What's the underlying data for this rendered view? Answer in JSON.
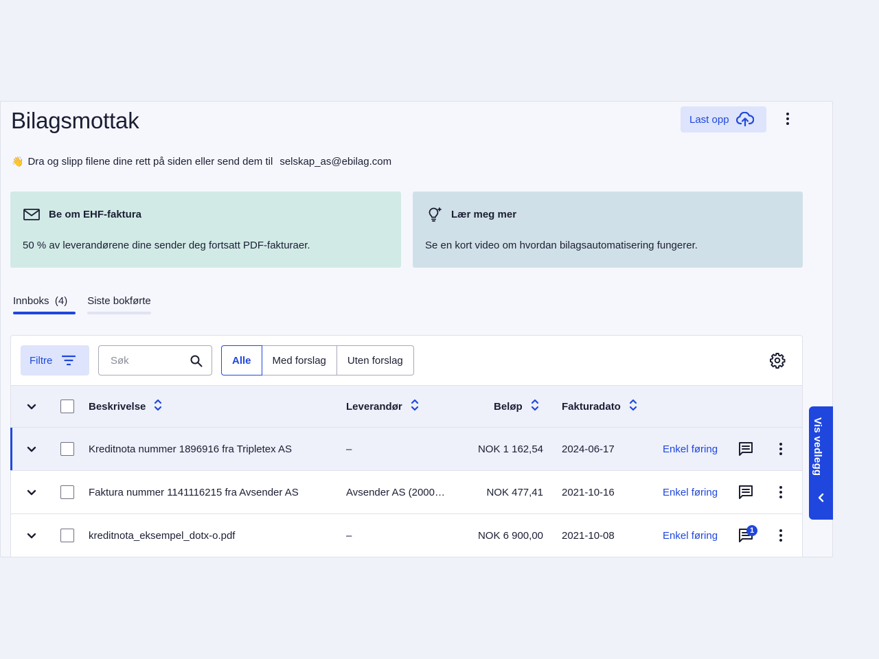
{
  "header": {
    "title": "Bilagsmottak",
    "upload_label": "Last opp"
  },
  "info": {
    "emoji": "👋",
    "text": "Dra og slipp filene dine rett på siden eller send dem til",
    "email": "selskap_as@ebilag.com"
  },
  "cards": [
    {
      "title": "Be om EHF-faktura",
      "body": "50 % av leverandørene dine sender deg fortsatt PDF-fakturaer.",
      "icon": "envelope-icon",
      "color": "#d1eae6"
    },
    {
      "title": "Lær meg mer",
      "body": "Se en kort video om hvordan bilagsautomatisering fungerer.",
      "icon": "lightbulb-icon",
      "color": "#d0e0e8"
    }
  ],
  "tabs": [
    {
      "label": "Innboks  (4)",
      "active": true
    },
    {
      "label": "Siste bokførte",
      "active": false
    }
  ],
  "toolbar": {
    "filter_label": "Filtre",
    "search_placeholder": "Søk",
    "segments": [
      "Alle",
      "Med forslag",
      "Uten forslag"
    ],
    "selected_segment": "Alle"
  },
  "table": {
    "columns": {
      "description": "Beskrivelse",
      "supplier": "Leverandør",
      "amount": "Beløp",
      "invoice_date": "Fakturadato"
    },
    "rows": [
      {
        "description": "Kreditnota nummer 1896916 fra Tripletex AS",
        "supplier": "–",
        "amount": "NOK 1 162,54",
        "date": "2024-06-17",
        "action": "Enkel føring",
        "comments": ""
      },
      {
        "description": "Faktura nummer 1141116215 fra Avsender AS",
        "supplier": "Avsender AS (2000…",
        "amount": "NOK 477,41",
        "date": "2021-10-16",
        "action": "Enkel føring",
        "comments": ""
      },
      {
        "description": "kreditnota_eksempel_dotx-o.pdf",
        "supplier": "–",
        "amount": "NOK 6 900,00",
        "date": "2021-10-08",
        "action": "Enkel føring",
        "comments": "1"
      }
    ]
  },
  "side_panel": {
    "label": "Vis vedlegg"
  },
  "colors": {
    "accent": "#1f47dd",
    "background": "#f0f2f9"
  }
}
